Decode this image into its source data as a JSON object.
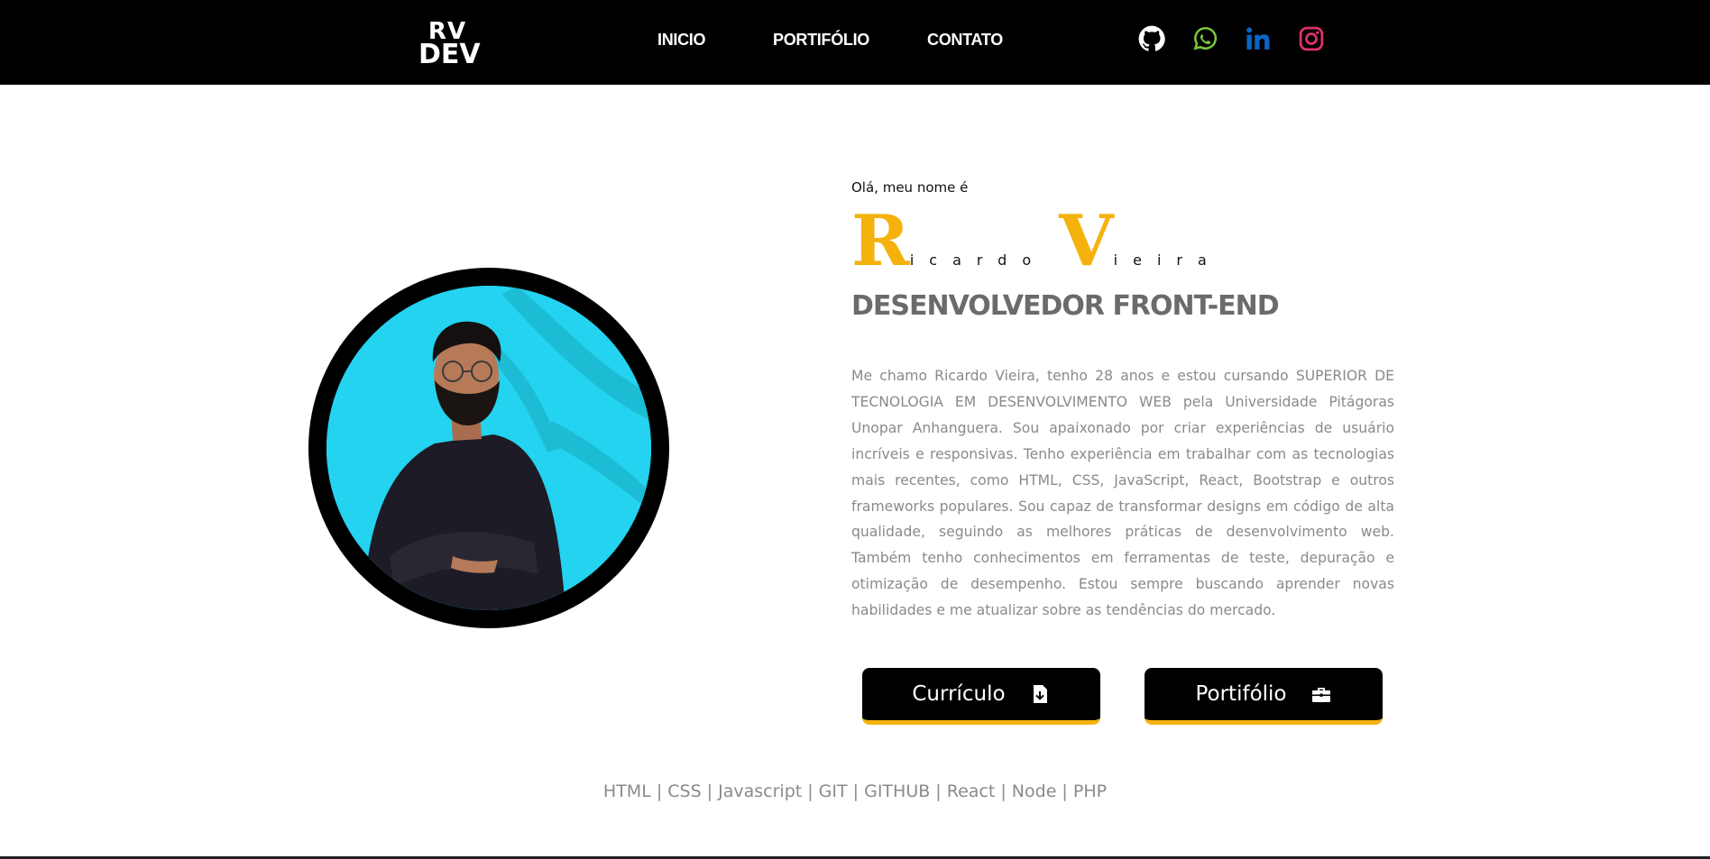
{
  "header": {
    "logo_line1": "RV",
    "logo_line2": "DEV",
    "nav": [
      "INICIO",
      "PORTIFÓLIO",
      "CONTATO"
    ],
    "social_icons": [
      "github-icon",
      "whatsapp-icon",
      "linkedin-icon",
      "instagram-icon"
    ],
    "social_colors": {
      "github": "#ffffff",
      "whatsapp": "#7bc73b",
      "linkedin": "#0a66c2",
      "instagram": "#e1306c"
    }
  },
  "hero": {
    "greeting": "Olá, meu nome é",
    "first_initial": "R",
    "first_rest": "icardo",
    "last_initial": "V",
    "last_rest": "ieira",
    "role": "DESENVOLVEDOR FRONT-END",
    "bio": "Me chamo Ricardo Vieira, tenho 28 anos e estou cursando SUPERIOR DE TECNOLOGIA EM DESENVOLVIMENTO WEB pela Universidade Pitágoras Unopar Anhanguera. Sou apaixonado por criar experiências de usuário incríveis e responsivas. Tenho experiência em trabalhar com as tecnologias mais recentes, como HTML, CSS, JavaScript, React, Bootstrap e outros frameworks populares. Sou capaz de transformar designs em código de alta qualidade, seguindo as melhores práticas de desenvolvimento web. Também tenho conhecimentos em ferramentas de teste, depuração e otimização de desempenho. Estou sempre buscando aprender novas habilidades e me atualizar sobre as tendências do mercado.",
    "buttons": {
      "resume": "Currículo",
      "portfolio": "Portifólio"
    },
    "accent_color": "#f5b20c"
  },
  "skills": "HTML | CSS | Javascript | GIT | GITHUB | React | Node | PHP"
}
